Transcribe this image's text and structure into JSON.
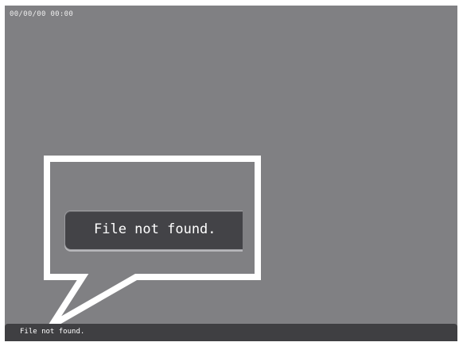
{
  "header": {
    "datetime": "00/00/00 00:00"
  },
  "popup": {
    "message": "File not found."
  },
  "status_bar": {
    "message": "File not found."
  },
  "colors": {
    "screen_background": "#808083",
    "popup_background": "#434347",
    "status_bar_background": "#3f3f42",
    "callout_outline": "#ffffff",
    "text": "#ffffff"
  }
}
